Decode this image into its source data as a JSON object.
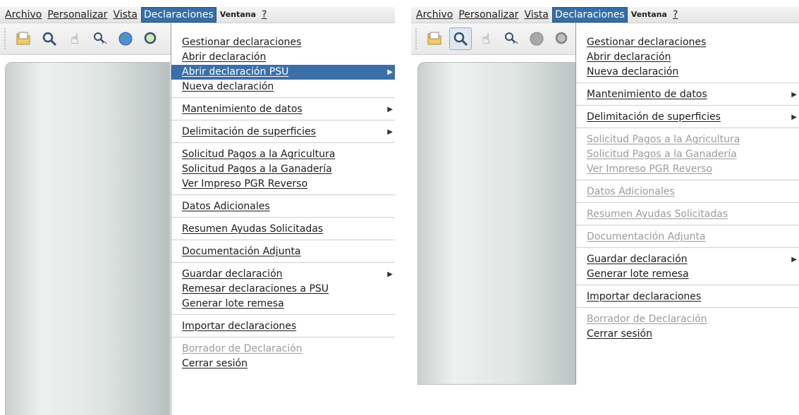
{
  "colors": {
    "menu_highlight": "#356ea6",
    "item_selected": "#3c6fa8",
    "disabled_text": "#9b9b9b"
  },
  "left": {
    "menubar": [
      "Archivo",
      "Personalizar",
      "Vista",
      "Declaraciones",
      "Ventana",
      "?"
    ],
    "active_menu": "Declaraciones",
    "toolbar_icons": [
      "open-folder-icon",
      "zoom-icon",
      "pan-hand-icon",
      "zoom-hand-icon",
      "globe-icon",
      "search-globe-icon"
    ],
    "menu": {
      "gestionar": "Gestionar declaraciones",
      "abrir": "Abrir declaración",
      "abrir_psu": "Abrir declaración PSU",
      "nueva": "Nueva declaración",
      "mantenimiento": "Mantenimiento de datos",
      "delimitacion": "Delimitación de superficies",
      "solicitud_agri": "Solicitud Pagos a la Agricultura",
      "solicitud_gana": "Solicitud Pagos a la Ganadería",
      "ver_impreso": "Ver Impreso PGR Reverso",
      "datos": "Datos Adicionales",
      "resumen": "Resumen Ayudas Solicitadas",
      "documentacion": "Documentación Adjunta",
      "guardar": "Guardar declaración",
      "remesar": "Remesar declaraciones a PSU",
      "generar": "Generar lote remesa",
      "importar": "Importar declaraciones",
      "borrador": "Borrador de Declaración",
      "cerrar": "Cerrar sesión"
    }
  },
  "right": {
    "menubar": [
      "Archivo",
      "Personalizar",
      "Vista",
      "Declaraciones",
      "Ventana",
      "?"
    ],
    "active_menu": "Declaraciones",
    "toolbar_icons": [
      "open-folder-icon",
      "zoom-icon",
      "pan-hand-icon",
      "zoom-hand-icon",
      "globe-icon",
      "search-globe-icon"
    ],
    "menu": {
      "gestionar": "Gestionar declaraciones",
      "abrir": "Abrir declaración",
      "nueva": "Nueva declaración",
      "mantenimiento": "Mantenimiento de datos",
      "delimitacion": "Delimitación de superficies",
      "solicitud_agri": "Solicitud Pagos a la Agricultura",
      "solicitud_gana": "Solicitud Pagos a la Ganadería",
      "ver_impreso": "Ver Impreso PGR Reverso",
      "datos": "Datos Adicionales",
      "resumen": "Resumen Ayudas Solicitadas",
      "documentacion": "Documentación Adjunta",
      "guardar": "Guardar declaración",
      "generar": "Generar lote remesa",
      "importar": "Importar declaraciones",
      "borrador": "Borrador de Declaración",
      "cerrar": "Cerrar sesión"
    }
  }
}
